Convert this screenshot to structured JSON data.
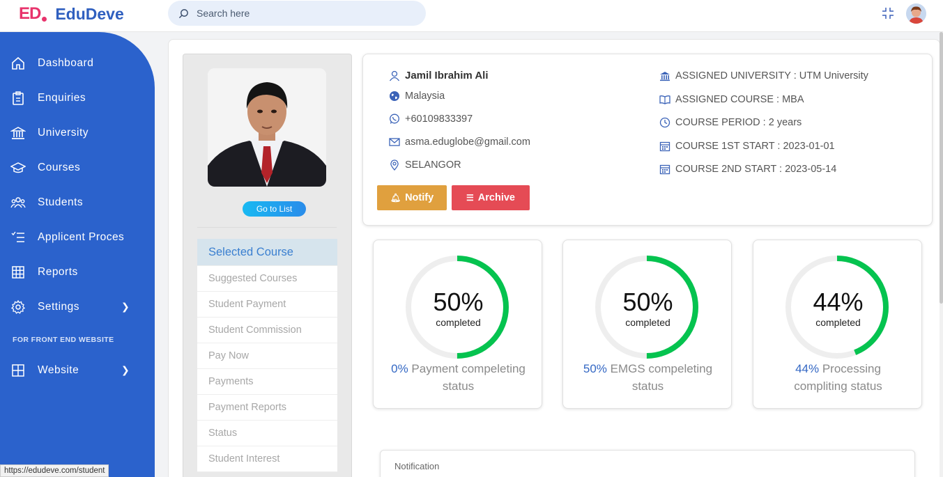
{
  "app": {
    "logo_mark": "ED",
    "logo_name": "EduDeve",
    "search_placeholder": "Search here"
  },
  "sidebar": {
    "items": [
      {
        "label": "Dashboard",
        "icon": "home-icon"
      },
      {
        "label": "Enquiries",
        "icon": "clipboard-icon"
      },
      {
        "label": "University",
        "icon": "bank-icon"
      },
      {
        "label": "Courses",
        "icon": "graduation-cap-icon"
      },
      {
        "label": "Students",
        "icon": "users-icon"
      },
      {
        "label": "Applicent Proces",
        "icon": "checklist-icon"
      },
      {
        "label": "Reports",
        "icon": "grid-icon"
      },
      {
        "label": "Settings",
        "icon": "gear-icon",
        "has_submenu": true
      }
    ],
    "section_label": "FOR FRONT END WEBSITE",
    "section_items": [
      {
        "label": "Website",
        "icon": "layout-icon",
        "has_submenu": true
      }
    ]
  },
  "status_url": "https://edudeve.com/student",
  "profile": {
    "go_to_list": "Go to List",
    "name": "Jamil Ibrahim Ali",
    "country": "Malaysia",
    "phone": "+60109833397",
    "email": "asma.eduglobe@gmail.com",
    "state": "SELANGOR",
    "assigned_university": "ASSIGNED UNIVERSITY : UTM University",
    "assigned_course": "ASSIGNED COURSE : MBA",
    "course_period": "COURSE PERIOD : 2 years",
    "course_1st_start": "COURSE 1ST START : 2023-01-01",
    "course_2nd_start": "COURSE 2ND START : 2023-05-14",
    "notify_label": "Notify",
    "archive_label": "Archive"
  },
  "course_menu": [
    {
      "label": "Selected Course",
      "active": true
    },
    {
      "label": "Suggested Courses"
    },
    {
      "label": "Student Payment"
    },
    {
      "label": "Student Commission"
    },
    {
      "label": "Pay Now"
    },
    {
      "label": "Payments"
    },
    {
      "label": "Payment Reports"
    },
    {
      "label": "Status"
    },
    {
      "label": "Student Interest"
    }
  ],
  "stats": [
    {
      "percent_text": "50%",
      "fraction": 0.5,
      "sub": "completed",
      "hl": "0%",
      "caption": " Payment compeleting status"
    },
    {
      "percent_text": "50%",
      "fraction": 0.5,
      "sub": "completed",
      "hl": "50%",
      "caption": " EMGS compeleting status"
    },
    {
      "percent_text": "44%",
      "fraction": 0.44,
      "sub": "completed",
      "hl": "44%",
      "caption": " Processing compliting status"
    }
  ],
  "notification_title": "Notification",
  "colors": {
    "sidebar": "#2b62cc",
    "ring_progress": "#05c34f",
    "ring_track": "#eeeeee",
    "notify": "#e0a03e",
    "archive": "#e54b55"
  }
}
